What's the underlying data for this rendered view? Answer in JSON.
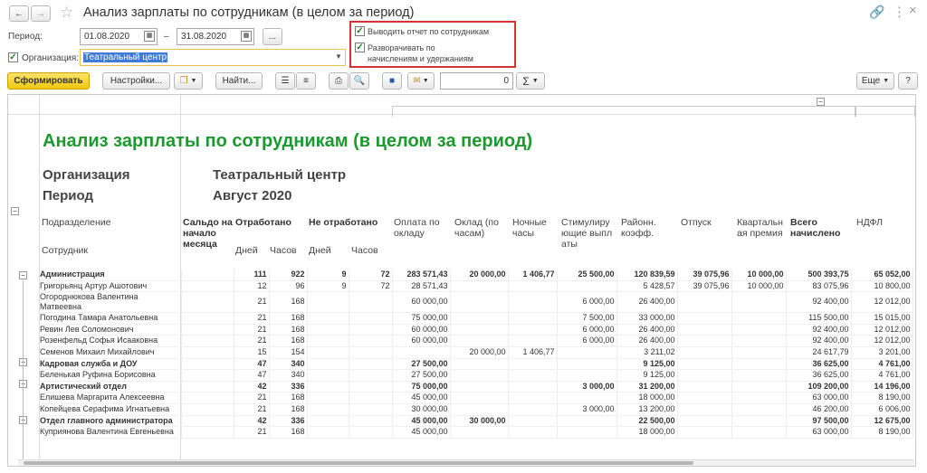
{
  "window": {
    "title": "Анализ зарплаты по сотрудникам (в целом за период)"
  },
  "params": {
    "period_label": "Период:",
    "date_from": "01.08.2020",
    "date_dash": "–",
    "date_to": "31.08.2020",
    "ellipsis": "...",
    "org_label": "Организация:",
    "org_value": "Театральный центр",
    "opt1": "Выводить отчет по сотрудникам",
    "opt2_line1": "Разворачивать по",
    "opt2_line2": "начислениям и удержаниям"
  },
  "toolbar": {
    "generate": "Сформировать",
    "settings": "Настройки...",
    "find": "Найти...",
    "sum_value": "0",
    "sigma": "Σ",
    "more": "Еще"
  },
  "report": {
    "title": "Анализ зарплаты по сотрудникам (в целом за период)",
    "org_label": "Организация",
    "org_value": "Театральный центр",
    "period_label": "Период",
    "period_value": "Август 2020",
    "head": {
      "dept": "Подразделение",
      "emp": "Сотрудник",
      "saldo": "Сальдо на начало месяца",
      "worked": "Отработано",
      "notworked": "Не отработано",
      "days": "Дней",
      "hours": "Часов",
      "salary": "Оплата по окладу",
      "hourly": "Оклад (по часам)",
      "night": "Ночные часы",
      "stim": "Стимулирующие выплаты",
      "regional": "Районн. коэфф.",
      "vacation": "Отпуск",
      "quarterly": "Квартальная премия",
      "total": "Всего начислено",
      "ndfl": "НДФЛ"
    },
    "rows": [
      {
        "grp": true,
        "name": "Администрация",
        "wd": "111",
        "wh": "922",
        "nd": "9",
        "nh": "72",
        "sal": "283 571,43",
        "hr": "20 000,00",
        "ng": "1 406,77",
        "st": "25 500,00",
        "rg": "120 839,59",
        "vc": "39 075,96",
        "qt": "10 000,00",
        "tot": "500 393,75",
        "nd2": "65 052,00"
      },
      {
        "grp": false,
        "name": "Григорьянц Артур Ашотович",
        "wd": "12",
        "wh": "96",
        "nd": "9",
        "nh": "72",
        "sal": "28 571,43",
        "hr": "",
        "ng": "",
        "st": "",
        "rg": "5 428,57",
        "vc": "39 075,96",
        "qt": "10 000,00",
        "tot": "83 075,96",
        "nd2": "10 800,00"
      },
      {
        "grp": false,
        "wrap": true,
        "name": "Огороднюкова Валентина Матвеевна",
        "wd": "21",
        "wh": "168",
        "nd": "",
        "nh": "",
        "sal": "60 000,00",
        "hr": "",
        "ng": "",
        "st": "6 000,00",
        "rg": "26 400,00",
        "vc": "",
        "qt": "",
        "tot": "92 400,00",
        "nd2": "12 012,00"
      },
      {
        "grp": false,
        "name": "Погодина Тамара Анатольевна",
        "wd": "21",
        "wh": "168",
        "nd": "",
        "nh": "",
        "sal": "75 000,00",
        "hr": "",
        "ng": "",
        "st": "7 500,00",
        "rg": "33 000,00",
        "vc": "",
        "qt": "",
        "tot": "115 500,00",
        "nd2": "15 015,00"
      },
      {
        "grp": false,
        "name": "Ревин Лев Соломонович",
        "wd": "21",
        "wh": "168",
        "nd": "",
        "nh": "",
        "sal": "60 000,00",
        "hr": "",
        "ng": "",
        "st": "6 000,00",
        "rg": "26 400,00",
        "vc": "",
        "qt": "",
        "tot": "92 400,00",
        "nd2": "12 012,00"
      },
      {
        "grp": false,
        "name": "Розенфельд Софья Исааковна",
        "wd": "21",
        "wh": "168",
        "nd": "",
        "nh": "",
        "sal": "60 000,00",
        "hr": "",
        "ng": "",
        "st": "6 000,00",
        "rg": "26 400,00",
        "vc": "",
        "qt": "",
        "tot": "92 400,00",
        "nd2": "12 012,00"
      },
      {
        "grp": false,
        "name": "Семенов Михаил Михайлович",
        "wd": "15",
        "wh": "154",
        "nd": "",
        "nh": "",
        "sal": "",
        "hr": "20 000,00",
        "ng": "1 406,77",
        "st": "",
        "rg": "3 211,02",
        "vc": "",
        "qt": "",
        "tot": "24 617,79",
        "nd2": "3 201,00"
      },
      {
        "grp": true,
        "name": "Кадровая служба и ДОУ",
        "wd": "47",
        "wh": "340",
        "nd": "",
        "nh": "",
        "sal": "27 500,00",
        "hr": "",
        "ng": "",
        "st": "",
        "rg": "9 125,00",
        "vc": "",
        "qt": "",
        "tot": "36 625,00",
        "nd2": "4 761,00"
      },
      {
        "grp": false,
        "name": "Беленькая Руфина Борисовна",
        "wd": "47",
        "wh": "340",
        "nd": "",
        "nh": "",
        "sal": "27 500,00",
        "hr": "",
        "ng": "",
        "st": "",
        "rg": "9 125,00",
        "vc": "",
        "qt": "",
        "tot": "36 625,00",
        "nd2": "4 761,00"
      },
      {
        "grp": true,
        "name": "Артистический отдел",
        "wd": "42",
        "wh": "336",
        "nd": "",
        "nh": "",
        "sal": "75 000,00",
        "hr": "",
        "ng": "",
        "st": "3 000,00",
        "rg": "31 200,00",
        "vc": "",
        "qt": "",
        "tot": "109 200,00",
        "nd2": "14 196,00"
      },
      {
        "grp": false,
        "name": "Елишева Маргарита Алексеевна",
        "wd": "21",
        "wh": "168",
        "nd": "",
        "nh": "",
        "sal": "45 000,00",
        "hr": "",
        "ng": "",
        "st": "",
        "rg": "18 000,00",
        "vc": "",
        "qt": "",
        "tot": "63 000,00",
        "nd2": "8 190,00"
      },
      {
        "grp": false,
        "name": "Копейцева Серафима Игнатьевна",
        "wd": "21",
        "wh": "168",
        "nd": "",
        "nh": "",
        "sal": "30 000,00",
        "hr": "",
        "ng": "",
        "st": "3 000,00",
        "rg": "13 200,00",
        "vc": "",
        "qt": "",
        "tot": "46 200,00",
        "nd2": "6 006,00"
      },
      {
        "grp": true,
        "wrap": true,
        "name": "Отдел главного администратора",
        "wd": "42",
        "wh": "336",
        "nd": "",
        "nh": "",
        "sal": "45 000,00",
        "hr": "30 000,00",
        "ng": "",
        "st": "",
        "rg": "22 500,00",
        "vc": "",
        "qt": "",
        "tot": "97 500,00",
        "nd2": "12 675,00"
      },
      {
        "grp": false,
        "wrap": true,
        "name": "Куприянова Валентина Евгеньевна",
        "wd": "21",
        "wh": "168",
        "nd": "",
        "nh": "",
        "sal": "45 000,00",
        "hr": "",
        "ng": "",
        "st": "",
        "rg": "18 000,00",
        "vc": "",
        "qt": "",
        "tot": "63 000,00",
        "nd2": "8 190,00"
      }
    ]
  }
}
